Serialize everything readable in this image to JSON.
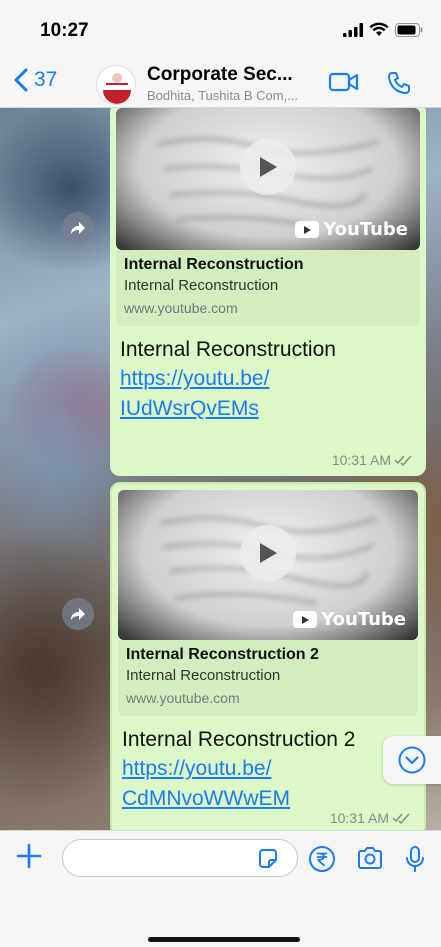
{
  "status_bar": {
    "time": "10:27"
  },
  "header": {
    "back_count": "37",
    "chat_title": "Corporate Sec...",
    "chat_subtitle": "Bodhita, Tushita B Com,..."
  },
  "messages": [
    {
      "preview_title": "Internal Reconstruction",
      "preview_description": "Internal Reconstruction",
      "preview_domain": "www.youtube.com",
      "text": "Internal Reconstruction",
      "link_line1": "https://youtu.be/",
      "link_line2": "IUdWsrQvEMs",
      "time": "10:31 AM",
      "brand": "YouTube"
    },
    {
      "preview_title": "Internal Reconstruction 2",
      "preview_description": "Internal Reconstruction",
      "preview_domain": "www.youtube.com",
      "text": "Internal Reconstruction 2",
      "link_line1": "https://youtu.be/",
      "link_line2": "CdMNvoWWwEM",
      "time": "10:31 AM",
      "brand": "YouTube"
    }
  ],
  "input": {
    "placeholder": ""
  },
  "colors": {
    "accent": "#1a7cf5",
    "bubble": "#dcf8c6",
    "link_card": "#d2eec0",
    "tick": "#8a8a8a"
  }
}
